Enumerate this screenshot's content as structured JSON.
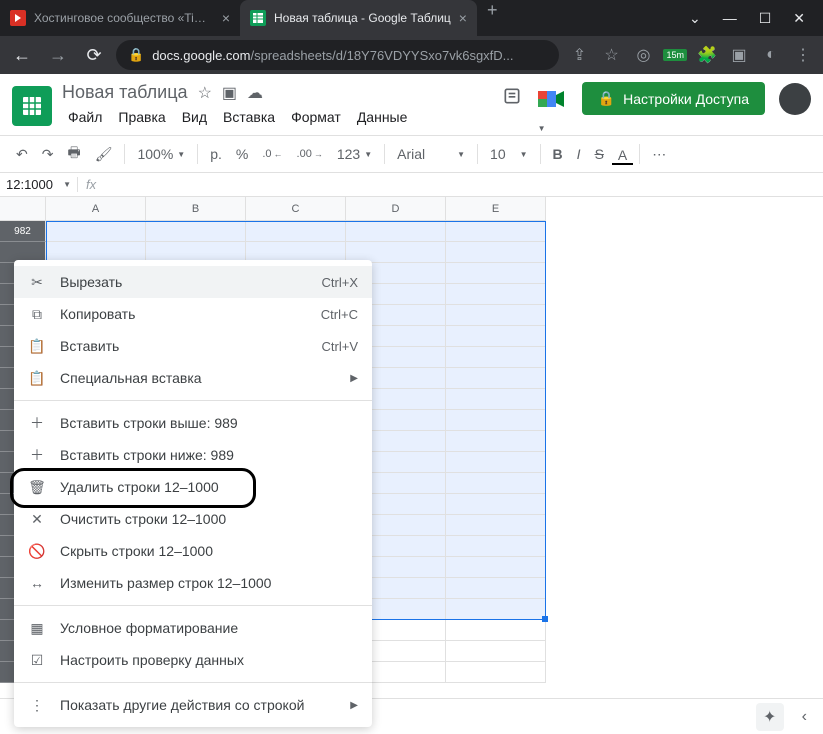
{
  "browser": {
    "tabs": [
      {
        "title": "Хостинговое сообщество «Time...",
        "active": false
      },
      {
        "title": "Новая таблица - Google Таблиц",
        "active": true
      }
    ],
    "url_domain": "docs.google.com",
    "url_path": "/spreadsheets/d/18Y76VDYYSxo7vk6sgxfD...",
    "ext_badge": "15m"
  },
  "sheets": {
    "title": "Новая таблица",
    "menus": [
      "Файл",
      "Правка",
      "Вид",
      "Вставка",
      "Формат",
      "Данные"
    ],
    "share_label": "Настройки Доступа"
  },
  "toolbar": {
    "zoom": "100%",
    "currency": "р.",
    "percent": "%",
    "dec_dec": ".0",
    "dec_inc": ".00",
    "format_123": "123",
    "font": "Arial",
    "font_size": "10",
    "bold": "B",
    "italic": "I",
    "strike": "S",
    "text_color": "A",
    "more": "⋯"
  },
  "formula": {
    "namebox": "12:1000",
    "fx": "fx"
  },
  "grid": {
    "columns": [
      "A",
      "B",
      "C",
      "D",
      "E"
    ],
    "first_row_label": "982"
  },
  "context_menu": {
    "items": [
      {
        "icon": "cut",
        "label": "Вырезать",
        "shortcut": "Ctrl+X",
        "hovered": true
      },
      {
        "icon": "copy",
        "label": "Копировать",
        "shortcut": "Ctrl+C"
      },
      {
        "icon": "paste",
        "label": "Вставить",
        "shortcut": "Ctrl+V"
      },
      {
        "icon": "paste-special",
        "label": "Специальная вставка",
        "submenu": true
      },
      {
        "sep": true
      },
      {
        "icon": "plus",
        "label": "Вставить строки выше: 989"
      },
      {
        "icon": "plus",
        "label": "Вставить строки ниже: 989"
      },
      {
        "icon": "trash",
        "label": "Удалить строки 12–1000",
        "highlighted": true
      },
      {
        "icon": "x",
        "label": "Очистить строки 12–1000"
      },
      {
        "icon": "hide",
        "label": "Скрыть строки 12–1000"
      },
      {
        "icon": "resize",
        "label": "Изменить размер строк 12–1000"
      },
      {
        "sep": true
      },
      {
        "icon": "format",
        "label": "Условное форматирование"
      },
      {
        "icon": "validate",
        "label": "Настроить проверку данных"
      },
      {
        "sep": true
      },
      {
        "icon": "more",
        "label": "Показать другие действия со строкой",
        "submenu": true
      }
    ]
  }
}
